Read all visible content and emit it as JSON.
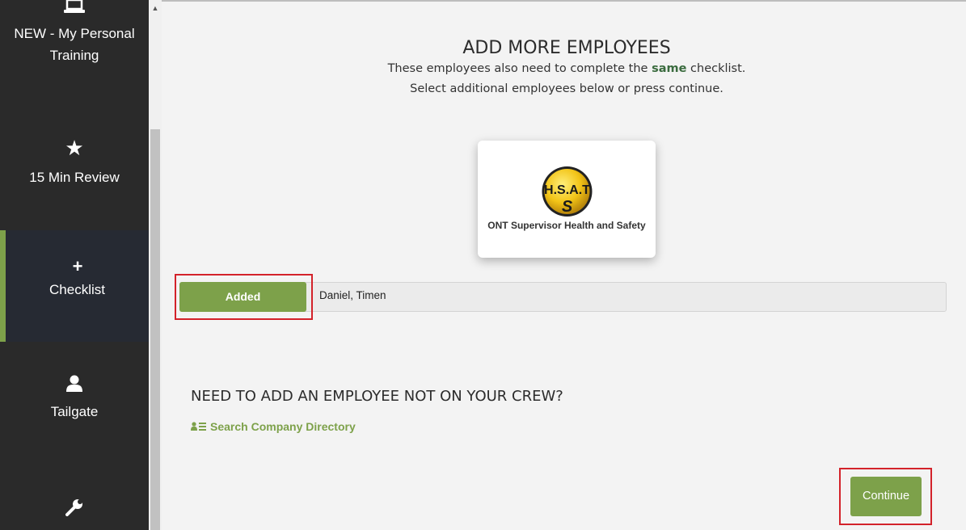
{
  "sidebar": {
    "items": [
      {
        "label": "NEW - My Personal Training",
        "icon": "laptop-icon"
      },
      {
        "label": "15 Min Review",
        "icon": "star-icon"
      },
      {
        "label": "Checklist",
        "icon": "plus-icon",
        "active": true
      },
      {
        "label": "Tailgate",
        "icon": "user-icon"
      },
      {
        "label": "",
        "icon": "wrench-icon"
      }
    ]
  },
  "main": {
    "title": "ADD MORE EMPLOYEES",
    "subtitle_pre": "These employees also need to complete the ",
    "subtitle_emphasis": "same",
    "subtitle_post": " checklist.",
    "subtitle_line2": "Select additional employees below or press continue.",
    "card": {
      "logo_text": "H.S.A.T",
      "logo_letter": "S",
      "label": "ONT Supervisor Health and Safety"
    },
    "employee": {
      "status_button": "Added",
      "name": "Daniel, Timen"
    },
    "section_heading": "NEED TO ADD AN EMPLOYEE NOT ON YOUR CREW?",
    "directory_link": "Search Company Directory",
    "continue_button": "Continue"
  },
  "colors": {
    "accent": "#7da14a",
    "sidebar_bg": "#2a2a2a",
    "highlight": "#d3222a"
  }
}
